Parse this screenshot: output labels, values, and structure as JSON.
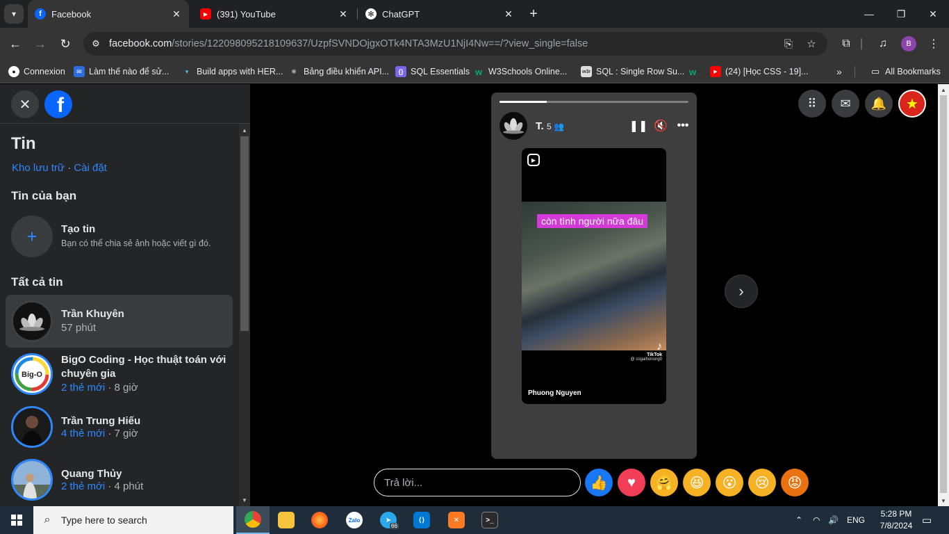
{
  "browser": {
    "tabs": [
      {
        "title": "Facebook",
        "icon": "facebook-icon",
        "active": true
      },
      {
        "title": "(391) YouTube",
        "icon": "youtube-icon",
        "active": false
      },
      {
        "title": "ChatGPT",
        "icon": "chatgpt-icon",
        "active": false
      }
    ],
    "url_host": "facebook.com",
    "url_path": "/stories/122098095218109637/UzpfSVNDOjgxOTk4NTA3MzU1NjI4Nw==/?view_single=false",
    "profile_letter": "B",
    "bookmarks": [
      {
        "label": "Connexion"
      },
      {
        "label": "Làm thế nào để sử..."
      },
      {
        "label": "Build apps with HER..."
      },
      {
        "label": "Bảng điều khiển API..."
      },
      {
        "label": "SQL Essentials"
      },
      {
        "label": "W3Schools Online..."
      },
      {
        "label": "SQL : Single Row Su..."
      },
      {
        "label": ""
      },
      {
        "label": "(24) [Học CSS - 19]..."
      }
    ],
    "all_bookmarks": "All Bookmarks"
  },
  "sidebar": {
    "title": "Tin",
    "archive_link": "Kho lưu trữ",
    "separator": "·",
    "settings_link": "Cài đặt",
    "your_stories_heading": "Tin của bạn",
    "create_title": "Tạo tin",
    "create_sub": "Bạn có thể chia sẻ ảnh hoặc viết gì đó.",
    "all_stories_heading": "Tất cả tin",
    "stories": [
      {
        "name": "Trần Khuyên",
        "new_count": "",
        "sep": "",
        "time": "57 phút",
        "selected": true
      },
      {
        "name": "BigO Coding - Học thuật toán với chuyên gia",
        "new_count": "2 thẻ mới",
        "sep": " · ",
        "time": "8 giờ",
        "selected": false
      },
      {
        "name": "Trần Trung Hiếu",
        "new_count": "4 thẻ mới",
        "sep": " · ",
        "time": "7 giờ",
        "selected": false
      },
      {
        "name": "Quang Thủy",
        "new_count": "2 thẻ mới",
        "sep": " · ",
        "time": "4 phút",
        "selected": false
      }
    ]
  },
  "story": {
    "author": "T.",
    "time": "5",
    "progress": 0.25,
    "caption": "còn tình người nữa đâu",
    "tiktok_label": "TikTok",
    "tiktok_handle": "@ cogaihonong0",
    "reel_author": "Phuong Nguyen",
    "reply_placeholder": "Trả lời...",
    "reactions": [
      "like",
      "love",
      "care",
      "haha",
      "wow",
      "sad",
      "angry"
    ]
  },
  "colors": {
    "accent": "#2d88ff",
    "fb_blue": "#0866ff",
    "panel_bg": "#242526",
    "caption_bg": "#d43ad8"
  },
  "taskbar": {
    "search_placeholder": "Type here to search",
    "lang": "ENG",
    "time": "5:28 PM",
    "date": "7/8/2024",
    "telegram_badge": "66"
  }
}
